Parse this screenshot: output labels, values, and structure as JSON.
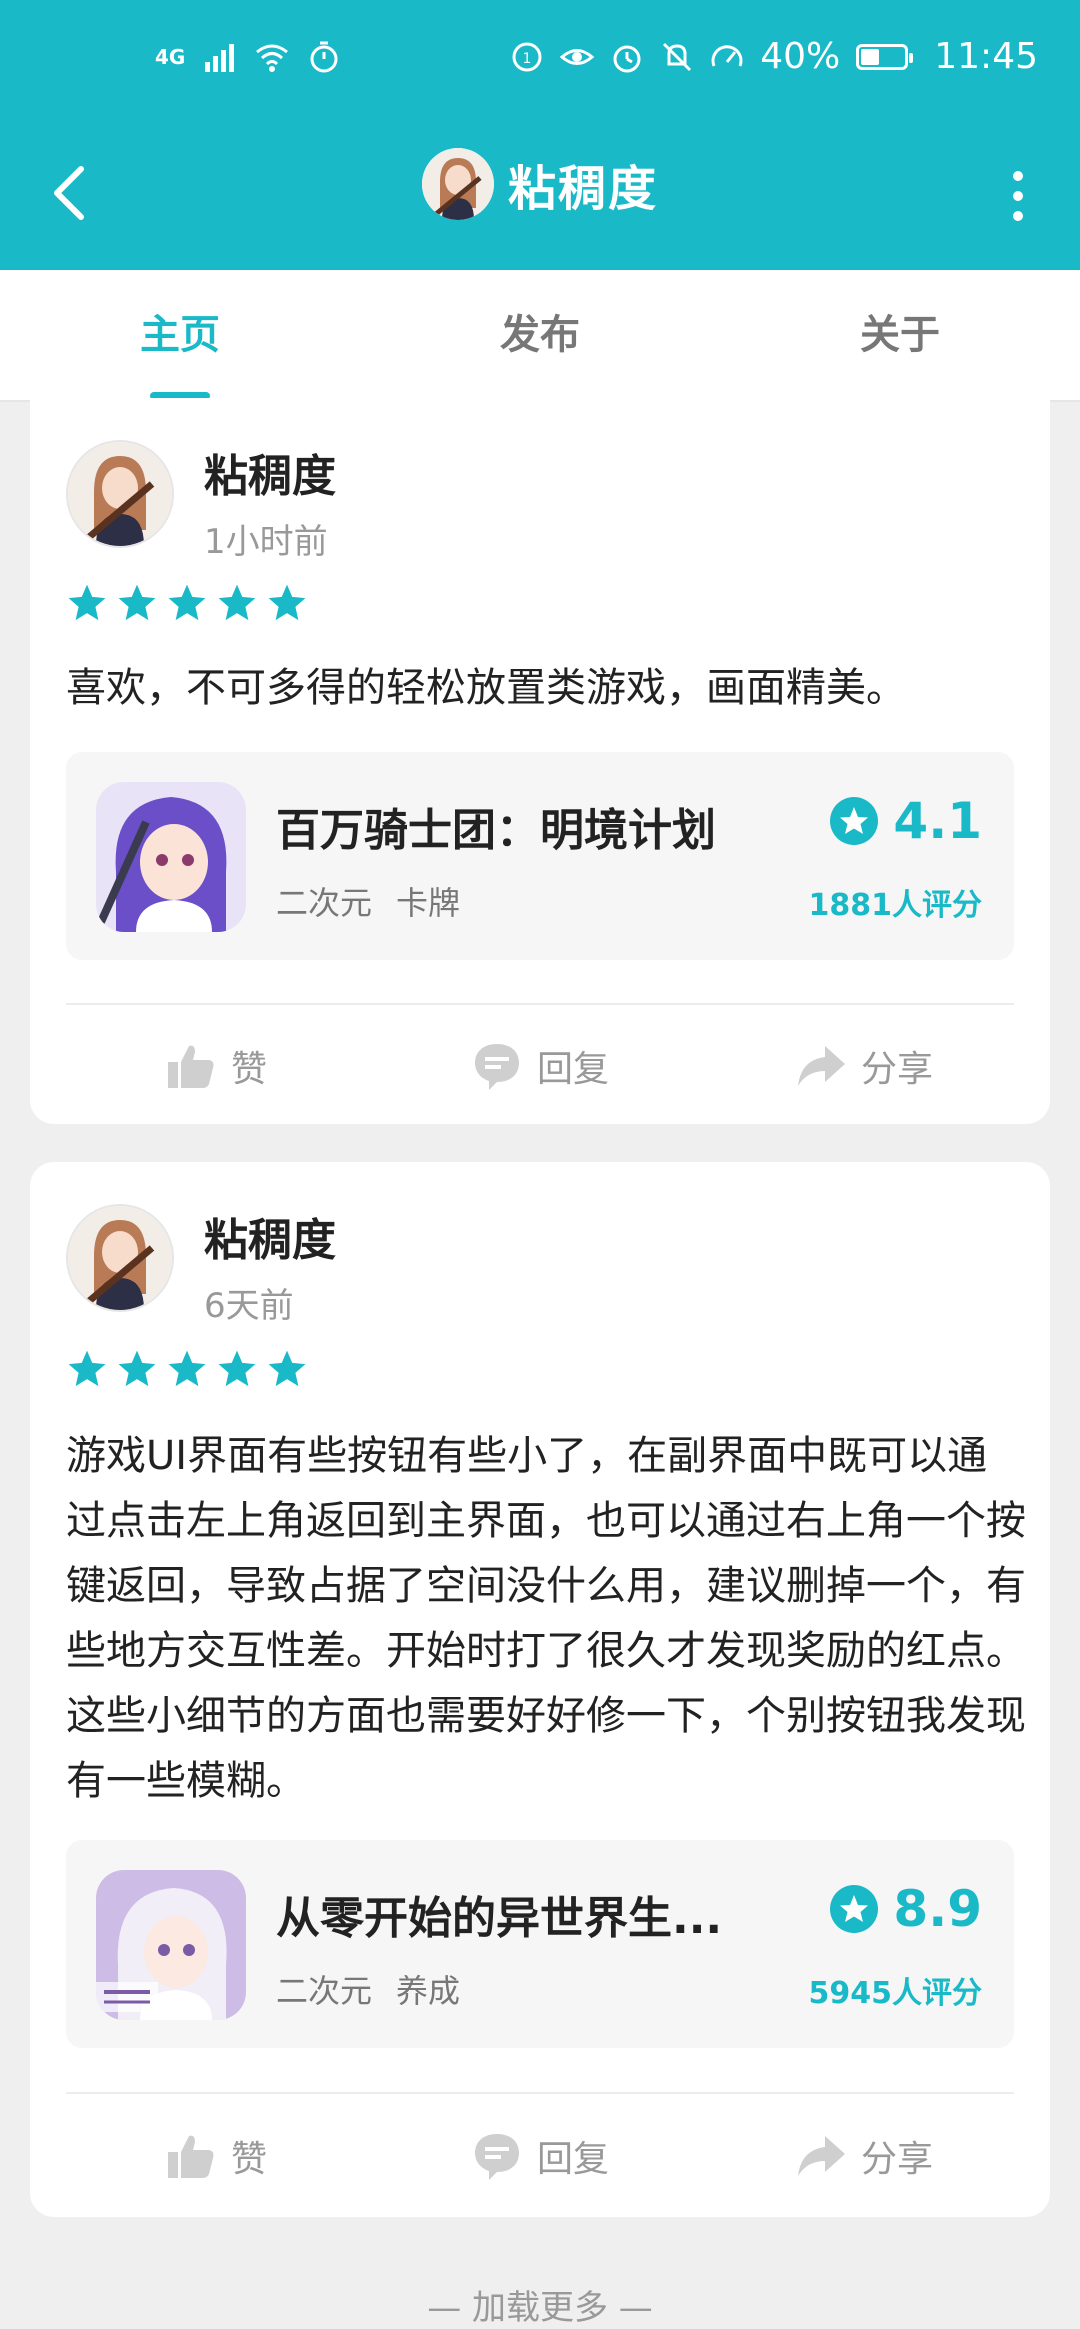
{
  "status_bar": {
    "network": "4G",
    "battery_percent": "40%",
    "time": "11:45"
  },
  "header": {
    "title": "粘稠度",
    "back_icon": "chevron-left-icon",
    "more_icon": "more-vertical-icon"
  },
  "tabs": [
    {
      "label": "主页",
      "active": true
    },
    {
      "label": "发布",
      "active": false
    },
    {
      "label": "关于",
      "active": false
    }
  ],
  "reviews": [
    {
      "author": "粘稠度",
      "time": "1小时前",
      "stars": 5,
      "text": "喜欢，不可多得的轻松放置类游戏，画面精美。",
      "game": {
        "title": "百万骑士团：明境计划",
        "tags": [
          "二次元",
          "卡牌"
        ],
        "rating": "4.1",
        "rating_count": "1881人评分"
      },
      "actions": {
        "like": "赞",
        "reply": "回复",
        "share": "分享"
      }
    },
    {
      "author": "粘稠度",
      "time": "6天前",
      "stars": 5,
      "text": "游戏UI界面有些按钮有些小了，在副界面中既可以通过点击左上角返回到主界面，也可以通过右上角一个按键返回，导致占据了空间没什么用，建议删掉一个，有些地方交互性差。开始时打了很久才发现奖励的红点。这些小细节的方面也需要好好修一下，个别按钮我发现有一些模糊。",
      "game": {
        "title": "从零开始的异世界生...",
        "tags": [
          "二次元",
          "养成"
        ],
        "rating": "8.9",
        "rating_count": "5945人评分"
      },
      "actions": {
        "like": "赞",
        "reply": "回复",
        "share": "分享"
      }
    }
  ],
  "footer": "— 加载更多 —",
  "colors": {
    "accent": "#19b9c8",
    "background": "#efefef",
    "card": "#ffffff"
  }
}
